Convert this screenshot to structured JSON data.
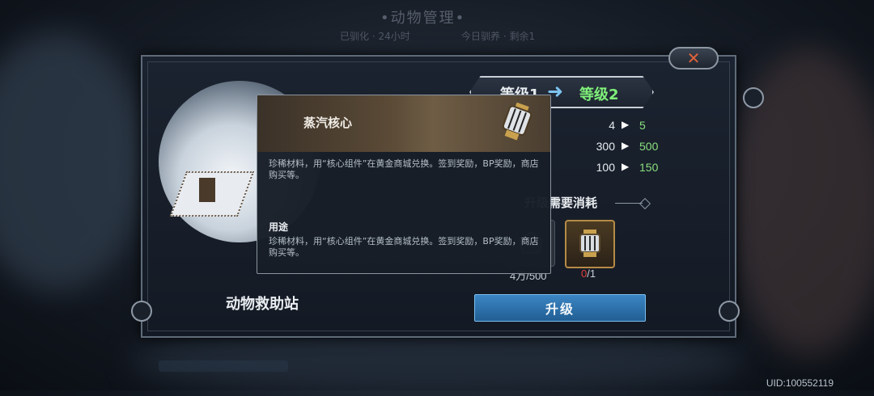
{
  "background": {
    "title": "•动物管理•",
    "sub_left": "已驯化 · 24小时",
    "sub_right": "今日驯养 · 剩余1"
  },
  "dialog": {
    "building_name": "动物救助站",
    "level_from": "等级1",
    "level_to": "等级2",
    "stats": [
      {
        "old": "4",
        "new": "5"
      },
      {
        "old": "300",
        "new": "500"
      },
      {
        "old": "100",
        "new": "150"
      }
    ],
    "cost_title": "升级需要消耗",
    "costs": [
      {
        "qty": "4万/500"
      },
      {
        "have": "0",
        "sep": "/",
        "need": "1"
      }
    ],
    "upgrade_label": "升级",
    "close_icon": "close-icon"
  },
  "tooltip": {
    "item_name": "蒸汽核心",
    "description": "珍稀材料，用“核心组件”在黄金商城兑换。签到奖励，BP奖励，商店购买等。",
    "use_title": "用途",
    "use_text": "珍稀材料，用“核心组件”在黄金商城兑换。签到奖励，BP奖励，商店购买等。"
  },
  "uid": "UID:100552119",
  "colors": {
    "accent_green": "#8be07e",
    "warning_red": "#e0413a",
    "button_blue": "#2f73ad"
  }
}
